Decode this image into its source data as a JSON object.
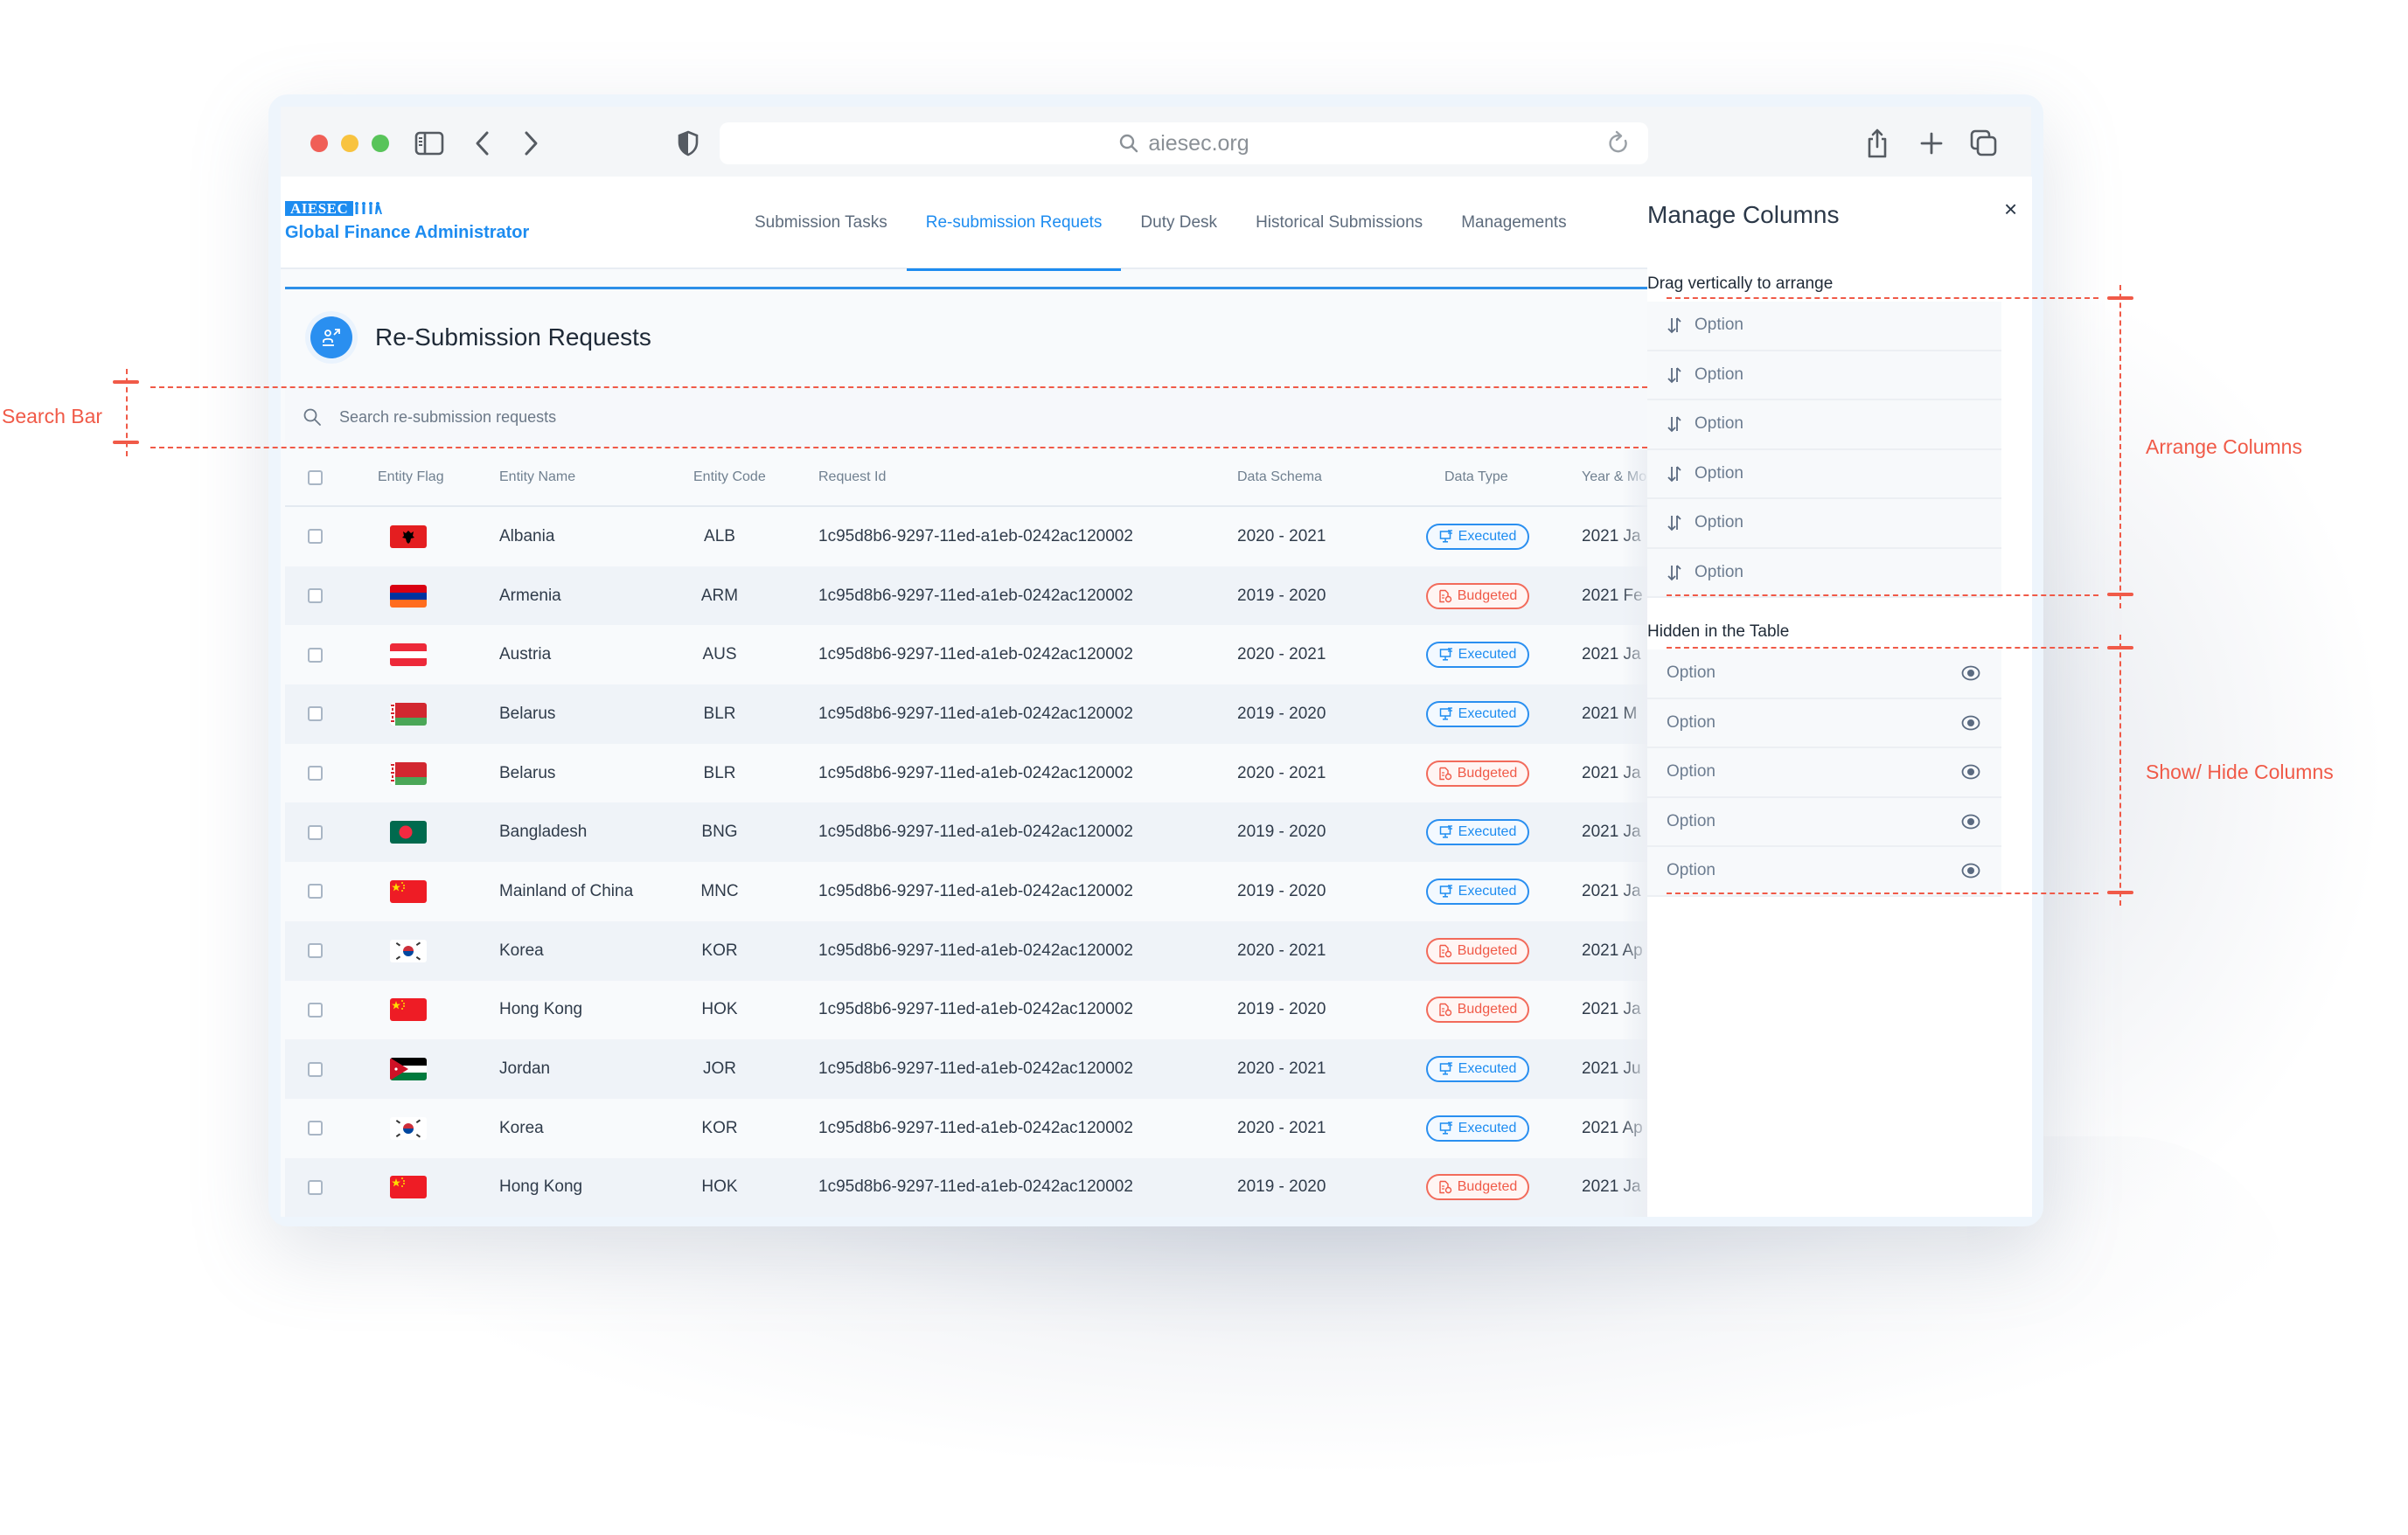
{
  "browser": {
    "url": "aiesec.org",
    "icons": [
      "sidebar-icon",
      "back-icon",
      "forward-icon",
      "shield-icon",
      "search-icon",
      "reload-icon",
      "share-icon",
      "new-tab-icon",
      "tabs-icon"
    ]
  },
  "app": {
    "logo_mark": "AIESEC",
    "logo_people": "⁣♣†††",
    "name": "Global Finance Administrator",
    "nav": [
      {
        "label": "Submission Tasks",
        "active": false
      },
      {
        "label": "Re-submission Requets",
        "active": true
      },
      {
        "label": "Duty Desk",
        "active": false
      },
      {
        "label": "Historical Submissions",
        "active": false
      },
      {
        "label": "Managements",
        "active": false
      }
    ]
  },
  "page": {
    "title": "Re-Submission Requests",
    "search_placeholder": "Search re-submission requests"
  },
  "table": {
    "columns": [
      "Entity Flag",
      "Entity Name",
      "Entity Code",
      "Request Id",
      "Data Schema",
      "Data Type",
      "Year & Mo"
    ],
    "rows": [
      {
        "flag": "albania",
        "name": "Albania",
        "code": "ALB",
        "request_id": "1c95d8b6-9297-11ed-a1eb-0242ac120002",
        "schema": "2020 - 2021",
        "type": "Executed",
        "year": "2021 Ja"
      },
      {
        "flag": "armenia",
        "name": "Armenia",
        "code": "ARM",
        "request_id": "1c95d8b6-9297-11ed-a1eb-0242ac120002",
        "schema": "2019 - 2020",
        "type": "Budgeted",
        "year": "2021 Fe"
      },
      {
        "flag": "austria",
        "name": "Austria",
        "code": "AUS",
        "request_id": "1c95d8b6-9297-11ed-a1eb-0242ac120002",
        "schema": "2020 - 2021",
        "type": "Executed",
        "year": "2021 Ja"
      },
      {
        "flag": "belarus",
        "name": "Belarus",
        "code": "BLR",
        "request_id": "1c95d8b6-9297-11ed-a1eb-0242ac120002",
        "schema": "2019 - 2020",
        "type": "Executed",
        "year": "2021 M"
      },
      {
        "flag": "belarus",
        "name": "Belarus",
        "code": "BLR",
        "request_id": "1c95d8b6-9297-11ed-a1eb-0242ac120002",
        "schema": "2020 - 2021",
        "type": "Budgeted",
        "year": "2021 Ja"
      },
      {
        "flag": "bangladesh",
        "name": "Bangladesh",
        "code": "BNG",
        "request_id": "1c95d8b6-9297-11ed-a1eb-0242ac120002",
        "schema": "2019 - 2020",
        "type": "Executed",
        "year": "2021 Ja"
      },
      {
        "flag": "china",
        "name": "Mainland of China",
        "code": "MNC",
        "request_id": "1c95d8b6-9297-11ed-a1eb-0242ac120002",
        "schema": "2019 - 2020",
        "type": "Executed",
        "year": "2021 Ja"
      },
      {
        "flag": "korea",
        "name": "Korea",
        "code": "KOR",
        "request_id": "1c95d8b6-9297-11ed-a1eb-0242ac120002",
        "schema": "2020 - 2021",
        "type": "Budgeted",
        "year": "2021 Ap"
      },
      {
        "flag": "china",
        "name": "Hong Kong",
        "code": "HOK",
        "request_id": "1c95d8b6-9297-11ed-a1eb-0242ac120002",
        "schema": "2019 - 2020",
        "type": "Budgeted",
        "year": "2021 Ja"
      },
      {
        "flag": "jordan",
        "name": "Jordan",
        "code": "JOR",
        "request_id": "1c95d8b6-9297-11ed-a1eb-0242ac120002",
        "schema": "2020 - 2021",
        "type": "Executed",
        "year": "2021 Ju"
      },
      {
        "flag": "korea",
        "name": "Korea",
        "code": "KOR",
        "request_id": "1c95d8b6-9297-11ed-a1eb-0242ac120002",
        "schema": "2020 - 2021",
        "type": "Executed",
        "year": "2021 Ap"
      },
      {
        "flag": "china",
        "name": "Hong Kong",
        "code": "HOK",
        "request_id": "1c95d8b6-9297-11ed-a1eb-0242ac120002",
        "schema": "2019 - 2020",
        "type": "Budgeted",
        "year": "2021 Ja"
      }
    ]
  },
  "panel": {
    "title": "Manage Columns",
    "close_label": "×",
    "arrange_label": "Drag vertically to arrange",
    "arrange_options": [
      "Option",
      "Option",
      "Option",
      "Option",
      "Option",
      "Option"
    ],
    "hidden_label": "Hidden in the Table",
    "hidden_options": [
      "Option",
      "Option",
      "Option",
      "Option",
      "Option"
    ]
  },
  "annotations": {
    "search_bar": "Search Bar",
    "arrange_columns": "Arrange Columns",
    "show_hide_columns": "Show/ Hide Columns"
  },
  "colors": {
    "accent": "#1d8cf0",
    "executed": "#1d8cf0",
    "budgeted": "#f05a48",
    "annotation": "#f05a48"
  }
}
